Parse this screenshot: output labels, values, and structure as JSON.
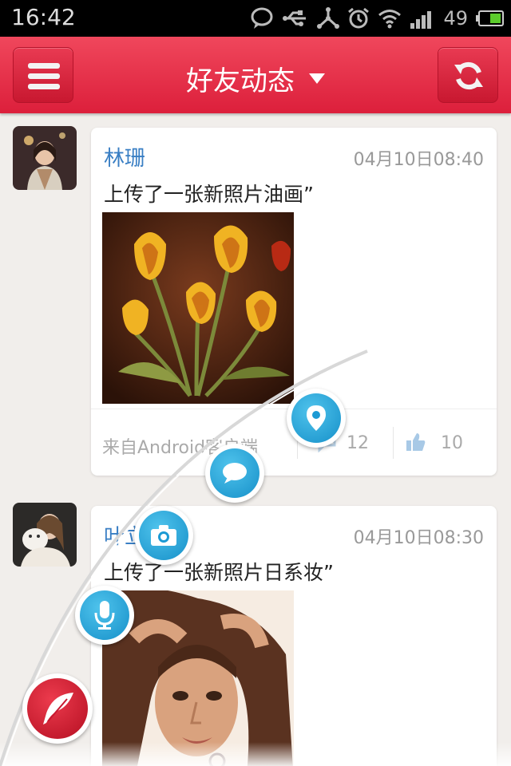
{
  "status_bar": {
    "time": "16:42",
    "battery": "49",
    "icons": [
      "chat-bubble-icon",
      "usb-icon",
      "share-icon",
      "alarm-icon",
      "wifi-icon",
      "signal-icon",
      "battery-icon"
    ]
  },
  "header": {
    "title": "好友动态",
    "menu_icon": "menu-icon",
    "refresh_icon": "refresh-icon",
    "color": "#e42b45"
  },
  "feed": [
    {
      "name": "林珊",
      "time": "04月10日08:40",
      "text": "上传了一张新照片油画”",
      "photo": "tulip-oil-painting",
      "source": "来自Android客户端",
      "comments": "12",
      "likes": "10"
    },
    {
      "name": "叶立",
      "time": "04月10日08:30",
      "text": "上传了一张新照片日系妆”",
      "photo": "woman-portrait"
    }
  ],
  "fab_menu": {
    "items": [
      "location-icon",
      "comment-icon",
      "camera-icon",
      "microphone-icon"
    ],
    "main": "feather-icon",
    "accent": "#1c9ad4",
    "main_color": "#d01a2e"
  }
}
